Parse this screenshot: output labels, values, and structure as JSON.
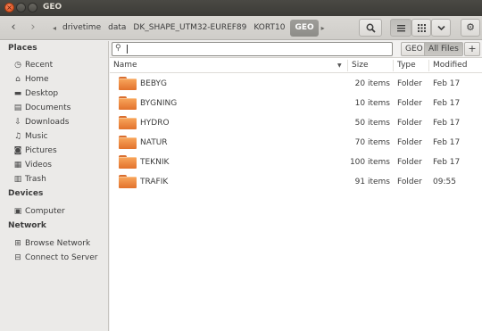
{
  "window": {
    "title": "GEO"
  },
  "toolbar": {
    "back_icon": "chevron-left-icon",
    "forward_icon": "chevron-right-icon",
    "breadcrumbs": [
      "drivetime",
      "data",
      "DK_SHAPE_UTM32-EUREF89",
      "KORT10"
    ],
    "current": "GEO"
  },
  "search": {
    "value": "",
    "location_label": "GEO",
    "all_files_label": "All Files",
    "add_label": "+"
  },
  "sidebar": {
    "places_label": "Places",
    "places": [
      {
        "label": "Recent",
        "icon": "clock-icon"
      },
      {
        "label": "Home",
        "icon": "home-icon"
      },
      {
        "label": "Desktop",
        "icon": "desktop-icon"
      },
      {
        "label": "Documents",
        "icon": "document-icon"
      },
      {
        "label": "Downloads",
        "icon": "download-icon"
      },
      {
        "label": "Music",
        "icon": "music-icon"
      },
      {
        "label": "Pictures",
        "icon": "picture-icon"
      },
      {
        "label": "Videos",
        "icon": "video-icon"
      },
      {
        "label": "Trash",
        "icon": "trash-icon"
      }
    ],
    "devices_label": "Devices",
    "devices": [
      {
        "label": "Computer",
        "icon": "computer-icon"
      }
    ],
    "network_label": "Network",
    "network": [
      {
        "label": "Browse Network",
        "icon": "network-icon"
      },
      {
        "label": "Connect to Server",
        "icon": "server-icon"
      }
    ]
  },
  "columns": {
    "name": "Name",
    "size": "Size",
    "type": "Type",
    "modified": "Modified"
  },
  "files": [
    {
      "name": "BEBYG",
      "size": "20 items",
      "type": "Folder",
      "modified": "Feb 17"
    },
    {
      "name": "BYGNING",
      "size": "10 items",
      "type": "Folder",
      "modified": "Feb 17"
    },
    {
      "name": "HYDRO",
      "size": "50 items",
      "type": "Folder",
      "modified": "Feb 17"
    },
    {
      "name": "NATUR",
      "size": "70 items",
      "type": "Folder",
      "modified": "Feb 17"
    },
    {
      "name": "TEKNIK",
      "size": "100 items",
      "type": "Folder",
      "modified": "Feb 17"
    },
    {
      "name": "TRAFIK",
      "size": "91 items",
      "type": "Folder",
      "modified": "09:55"
    }
  ]
}
